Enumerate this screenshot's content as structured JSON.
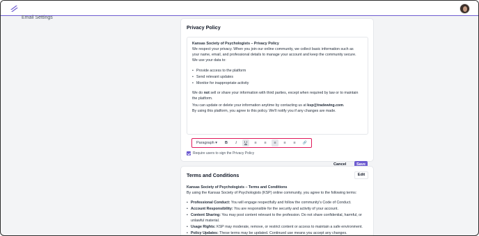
{
  "header": {
    "section_label": "Email Settings"
  },
  "privacy": {
    "title": "Privacy Policy",
    "heading": "Kansas Society of Psychologists – Privacy Policy",
    "p1": "We respect your privacy. When you join our online community, we collect basic information such as",
    "p2": "your name, email, and professional details to manage your account and keep the community secure.",
    "p3": "We use your data to:",
    "bullets": [
      "Provide access to the platform",
      "Send relevant updates",
      "Monitor for inappropriate activity"
    ],
    "p4_pre": "We do ",
    "p4_bold": "not",
    "p4_post": " sell or share your information with third parties, except when required by law or to maintain",
    "p5": "the platform.",
    "p6_pre": "You can update or delete your information anytime by contacting us at ",
    "p6_email": "ksp@tradewing.com",
    "p6_post": ".",
    "p7": "By using this platform, you agree to this policy. We'll notify you if any changes are made.",
    "toolbar": {
      "paragraph": "Paragraph",
      "chevron": "▾",
      "bold": "B",
      "italic": "I",
      "underline": "U",
      "ordered": "≡",
      "bulleted": "≡",
      "align_left": "≡",
      "align_center": "≡",
      "align_right": "≡",
      "link": "🔗"
    },
    "checkbox_label": "Require users to sign the Privacy Policy",
    "cancel": "Cancel",
    "save": "Save"
  },
  "terms": {
    "title": "Terms and Conditions",
    "edit": "Edit",
    "heading": "Kansas Society of Psychologists – Terms and Conditions",
    "intro": "By using the Kansas Society of Psychologists (KSP) online community, you agree to the following terms:",
    "items": [
      {
        "bold": "Professional Conduct:",
        "text": " You will engage respectfully and follow the community's Code of Conduct."
      },
      {
        "bold": "Account Responsibility:",
        "text": " You are responsible for the security and activity of your account."
      },
      {
        "bold": "Content Sharing:",
        "text": " You may post content relevant to the profession. Do not share confidential, harmful, or"
      },
      {
        "bold": "",
        "text": "unlawful material."
      },
      {
        "bold": "Usage Rights:",
        "text": " KSP may moderate, remove, or restrict content or access to maintain a safe environment."
      },
      {
        "bold": "Policy Updates:",
        "text": " These terms may be updated. Continued use means you accept any changes."
      }
    ]
  },
  "colors": {
    "accent": "#6d5bd0",
    "highlight": "#e0195a"
  }
}
